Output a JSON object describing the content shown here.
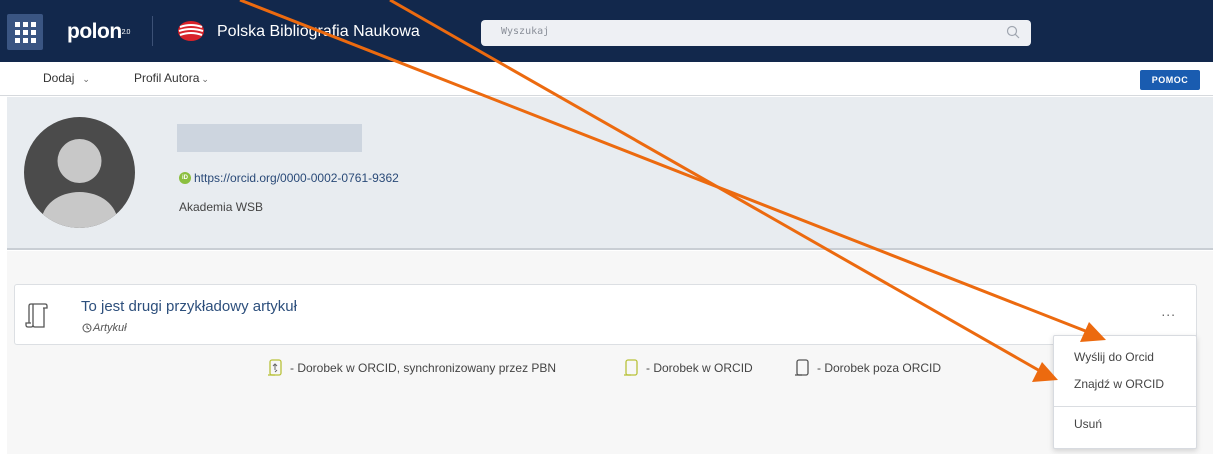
{
  "header": {
    "logo_text": "polon",
    "logo_version": "2.0",
    "app_title": "Polska Bibliografia Naukowa",
    "search": {
      "placeholder": "Wyszukaj"
    },
    "apps_icon": "grid-icon"
  },
  "subnav": {
    "items": [
      {
        "label": "Dodaj"
      },
      {
        "label": "Profil Autora"
      }
    ],
    "help_button": "POMOC"
  },
  "profile": {
    "orcid_url": "https://orcid.org/0000-0002-0761-9362",
    "affiliation": "Akademia WSB"
  },
  "publication": {
    "title": "To jest drugi przykładowy artykuł",
    "type": "Artykuł",
    "more_label": "..."
  },
  "legend": [
    {
      "label": "- Dorobek w ORCID, synchronizowany przez PBN",
      "icon": "scroll-sync-icon"
    },
    {
      "label": "- Dorobek w ORCID",
      "icon": "scroll-green-icon"
    },
    {
      "label": "- Dorobek poza ORCID",
      "icon": "scroll-gray-icon"
    }
  ],
  "dropdown": {
    "items": [
      {
        "label": "Wyślij do Orcid"
      },
      {
        "label": "Znajdź w ORCID"
      },
      {
        "label": "Usuń"
      }
    ]
  },
  "colors": {
    "topbar": "#12284c",
    "accent_blue": "#1a5cb0",
    "orcid_green": "#8bbf3f",
    "annotation_arrow": "#ec6a0f"
  }
}
